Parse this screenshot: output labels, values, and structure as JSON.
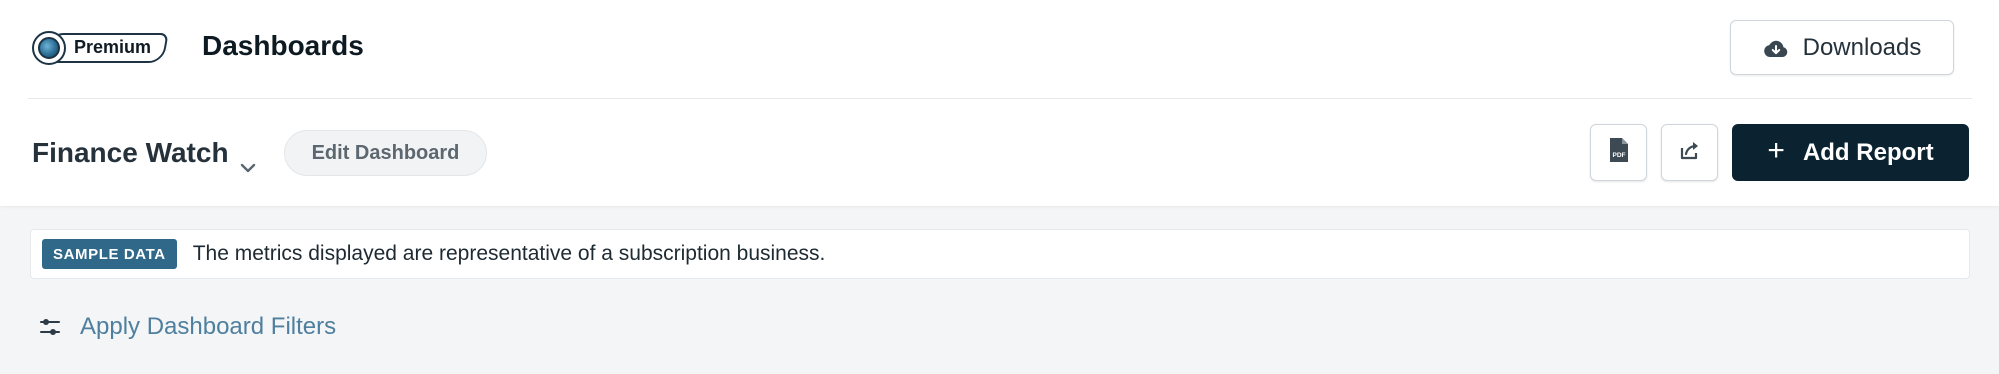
{
  "header": {
    "premium_label": "Premium",
    "title": "Dashboards",
    "downloads_label": "Downloads",
    "downloads_icon": "cloud-download-icon"
  },
  "toolbar": {
    "dashboard_name": "Finance Watch",
    "edit_label": "Edit Dashboard",
    "pdf_icon": "pdf-file-icon",
    "pdf_icon_text": "PDF",
    "share_icon": "share-icon",
    "add_report_label": "Add Report",
    "add_report_icon": "+"
  },
  "notice": {
    "badge": "SAMPLE DATA",
    "text": "The metrics displayed are representative of a subscription business."
  },
  "filters": {
    "label": "Apply Dashboard Filters",
    "icon": "sliders-icon"
  },
  "colors": {
    "primary_dark": "#0b2330",
    "badge_blue": "#2f6888",
    "link_blue": "#4f7f9e",
    "page_bg": "#f3f5f7"
  }
}
